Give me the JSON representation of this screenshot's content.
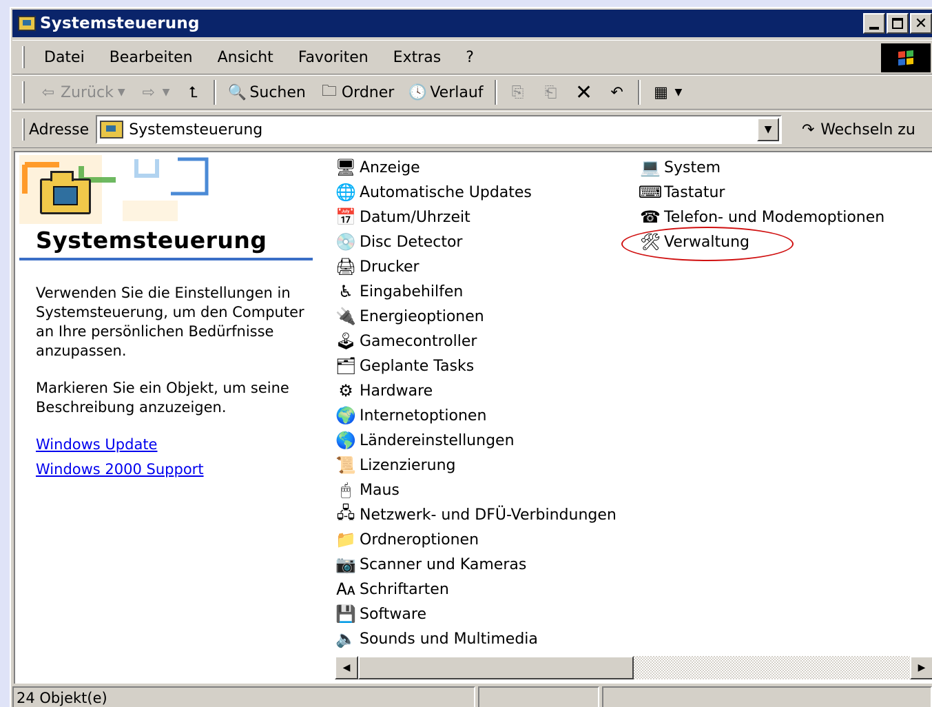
{
  "window": {
    "title": "Systemsteuerung",
    "controls": {
      "minimize": "minimize",
      "maximize": "maximize",
      "close": "✕"
    }
  },
  "menu": [
    "Datei",
    "Bearbeiten",
    "Ansicht",
    "Favoriten",
    "Extras",
    "?"
  ],
  "toolbar": {
    "back": "Zurück",
    "search": "Suchen",
    "folders": "Ordner",
    "history": "Verlauf"
  },
  "address": {
    "label": "Adresse",
    "value": "Systemsteuerung",
    "go": "Wechseln zu"
  },
  "left_panel": {
    "title": "Systemsteuerung",
    "description": "Verwenden Sie die Einstellungen in Systemsteuerung, um den Computer an Ihre persönlichen Bedürfnisse anzupassen.",
    "hint": "Markieren Sie ein Objekt, um seine Beschreibung anzuzeigen.",
    "links": [
      "Windows Update",
      "Windows 2000 Support"
    ]
  },
  "items_col1": [
    {
      "label": "Anzeige",
      "icon": "display-icon"
    },
    {
      "label": "Automatische Updates",
      "icon": "updates-icon"
    },
    {
      "label": "Datum/Uhrzeit",
      "icon": "calendar-icon"
    },
    {
      "label": "Disc Detector",
      "icon": "disc-icon"
    },
    {
      "label": "Drucker",
      "icon": "printer-icon"
    },
    {
      "label": "Eingabehilfen",
      "icon": "accessibility-icon"
    },
    {
      "label": "Energieoptionen",
      "icon": "power-icon"
    },
    {
      "label": "Gamecontroller",
      "icon": "joystick-icon"
    },
    {
      "label": "Geplante Tasks",
      "icon": "tasks-icon"
    },
    {
      "label": "Hardware",
      "icon": "hardware-icon"
    },
    {
      "label": "Internetoptionen",
      "icon": "internet-icon"
    },
    {
      "label": "Ländereinstellungen",
      "icon": "globe-icon"
    },
    {
      "label": "Lizenzierung",
      "icon": "license-icon"
    },
    {
      "label": "Maus",
      "icon": "mouse-icon"
    },
    {
      "label": "Netzwerk- und DFÜ-Verbindungen",
      "icon": "network-icon"
    },
    {
      "label": "Ordneroptionen",
      "icon": "folder-options-icon"
    },
    {
      "label": "Scanner und Kameras",
      "icon": "scanner-icon"
    },
    {
      "label": "Schriftarten",
      "icon": "fonts-icon"
    },
    {
      "label": "Software",
      "icon": "software-icon"
    },
    {
      "label": "Sounds und Multimedia",
      "icon": "speaker-icon"
    }
  ],
  "items_col2": [
    {
      "label": "System",
      "icon": "computer-icon"
    },
    {
      "label": "Tastatur",
      "icon": "keyboard-icon"
    },
    {
      "label": "Telefon- und Modemoptionen",
      "icon": "phone-icon"
    },
    {
      "label": "Verwaltung",
      "icon": "admin-tools-icon"
    }
  ],
  "status": {
    "objects": "24 Objekt(e)"
  },
  "colors": {
    "titlebar": "#0a246a",
    "highlight_circle": "#d01010",
    "link": "#0000ee"
  }
}
